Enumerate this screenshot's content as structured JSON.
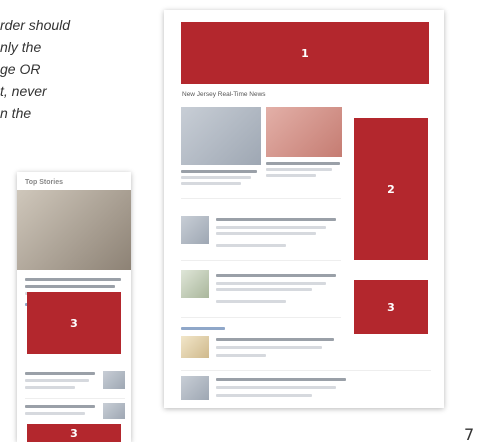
{
  "caption": "rder should\nnly the\nge OR\nt, never\nn the",
  "desktop": {
    "section_title": "New Jersey Real-Time News",
    "ad_slots": [
      "1",
      "2",
      "3"
    ]
  },
  "mobile": {
    "title": "Top Stories",
    "ad_slots": [
      "3",
      "3"
    ]
  },
  "page_number": "7",
  "colors": {
    "ad_red": "#b3272d"
  }
}
